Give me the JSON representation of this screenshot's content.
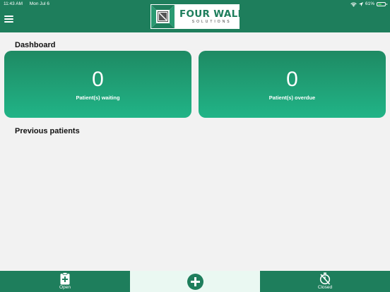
{
  "status_bar": {
    "time": "11:43 AM",
    "date": "Mon Jul 6",
    "battery": "61%",
    "battery_level": 0.61
  },
  "header": {
    "logo_text": "FOUR WALL",
    "logo_subtext": "SOLUTIONS",
    "menu_icon": "hamburger-menu-icon"
  },
  "dashboard": {
    "title": "Dashboard",
    "cards": [
      {
        "count": "0",
        "label": "Patient(s) waiting"
      },
      {
        "count": "0",
        "label": "Patient(s) overdue"
      }
    ]
  },
  "previous_patients": {
    "title": "Previous patients"
  },
  "tabbar": {
    "open_label": "Open",
    "closed_label": "Closed",
    "open_icon": "clipboard-plus-icon",
    "add_icon": "plus-circle-icon",
    "closed_icon": "timer-off-icon"
  },
  "colors": {
    "primary": "#1e7e5c",
    "card_gradient_top": "#1e8a63",
    "card_gradient_bottom": "#21b487",
    "background": "#f2f2f2"
  }
}
